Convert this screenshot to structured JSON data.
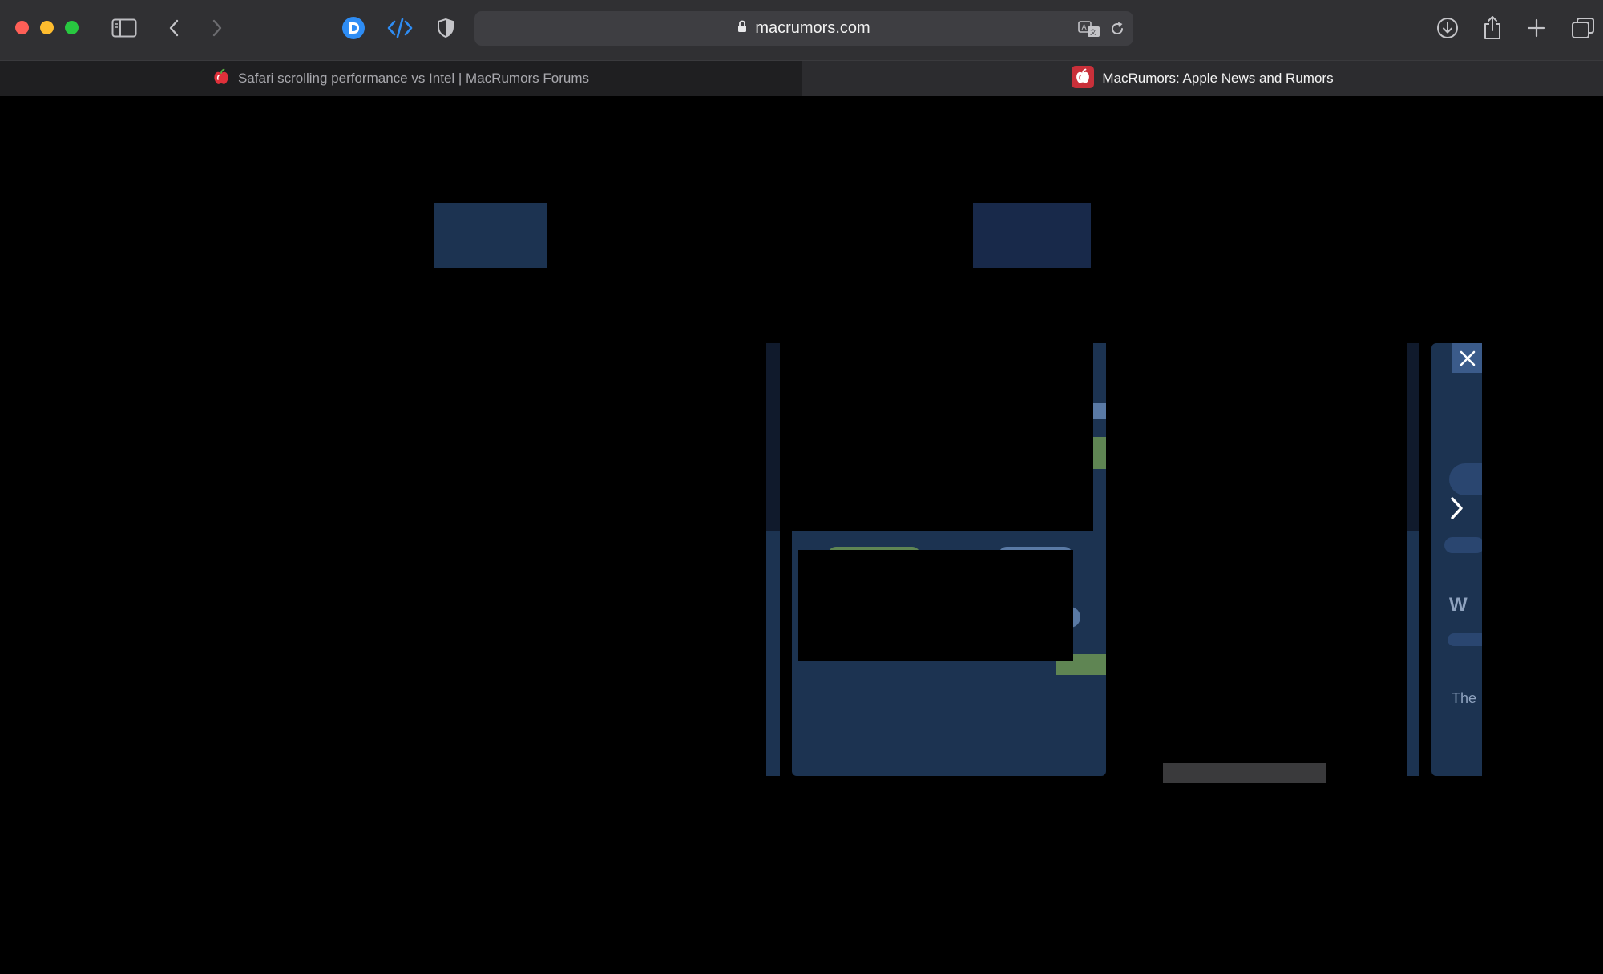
{
  "address_bar": {
    "url": "macrumors.com"
  },
  "tabs": [
    {
      "title": "Safari scrolling performance vs Intel | MacRumors Forums",
      "active": false
    },
    {
      "title": "MacRumors: Apple News and Rumors",
      "active": true
    }
  ],
  "page": {
    "partial_text_1": "W",
    "partial_text_2": "The"
  },
  "icons": {
    "toolbar": [
      "sidebar-icon",
      "back-icon",
      "forward-icon",
      "extension-d-icon",
      "code-icon",
      "shield-icon",
      "download-icon",
      "share-icon",
      "new-tab-icon",
      "tab-overview-icon"
    ],
    "address": [
      "lock-icon",
      "translate-icon",
      "reload-icon"
    ],
    "page": [
      "close-icon",
      "chevron-right-icon"
    ]
  },
  "colors": {
    "toolbar_bg": "#303033",
    "address_bg": "#3e3e42",
    "tab_inactive_bg": "#1f1f21",
    "tab_active_bg": "#2c2c2f",
    "accent_blue": "#2e8df5",
    "page_blue": "#1c3351",
    "page_green": "#5f8553"
  }
}
